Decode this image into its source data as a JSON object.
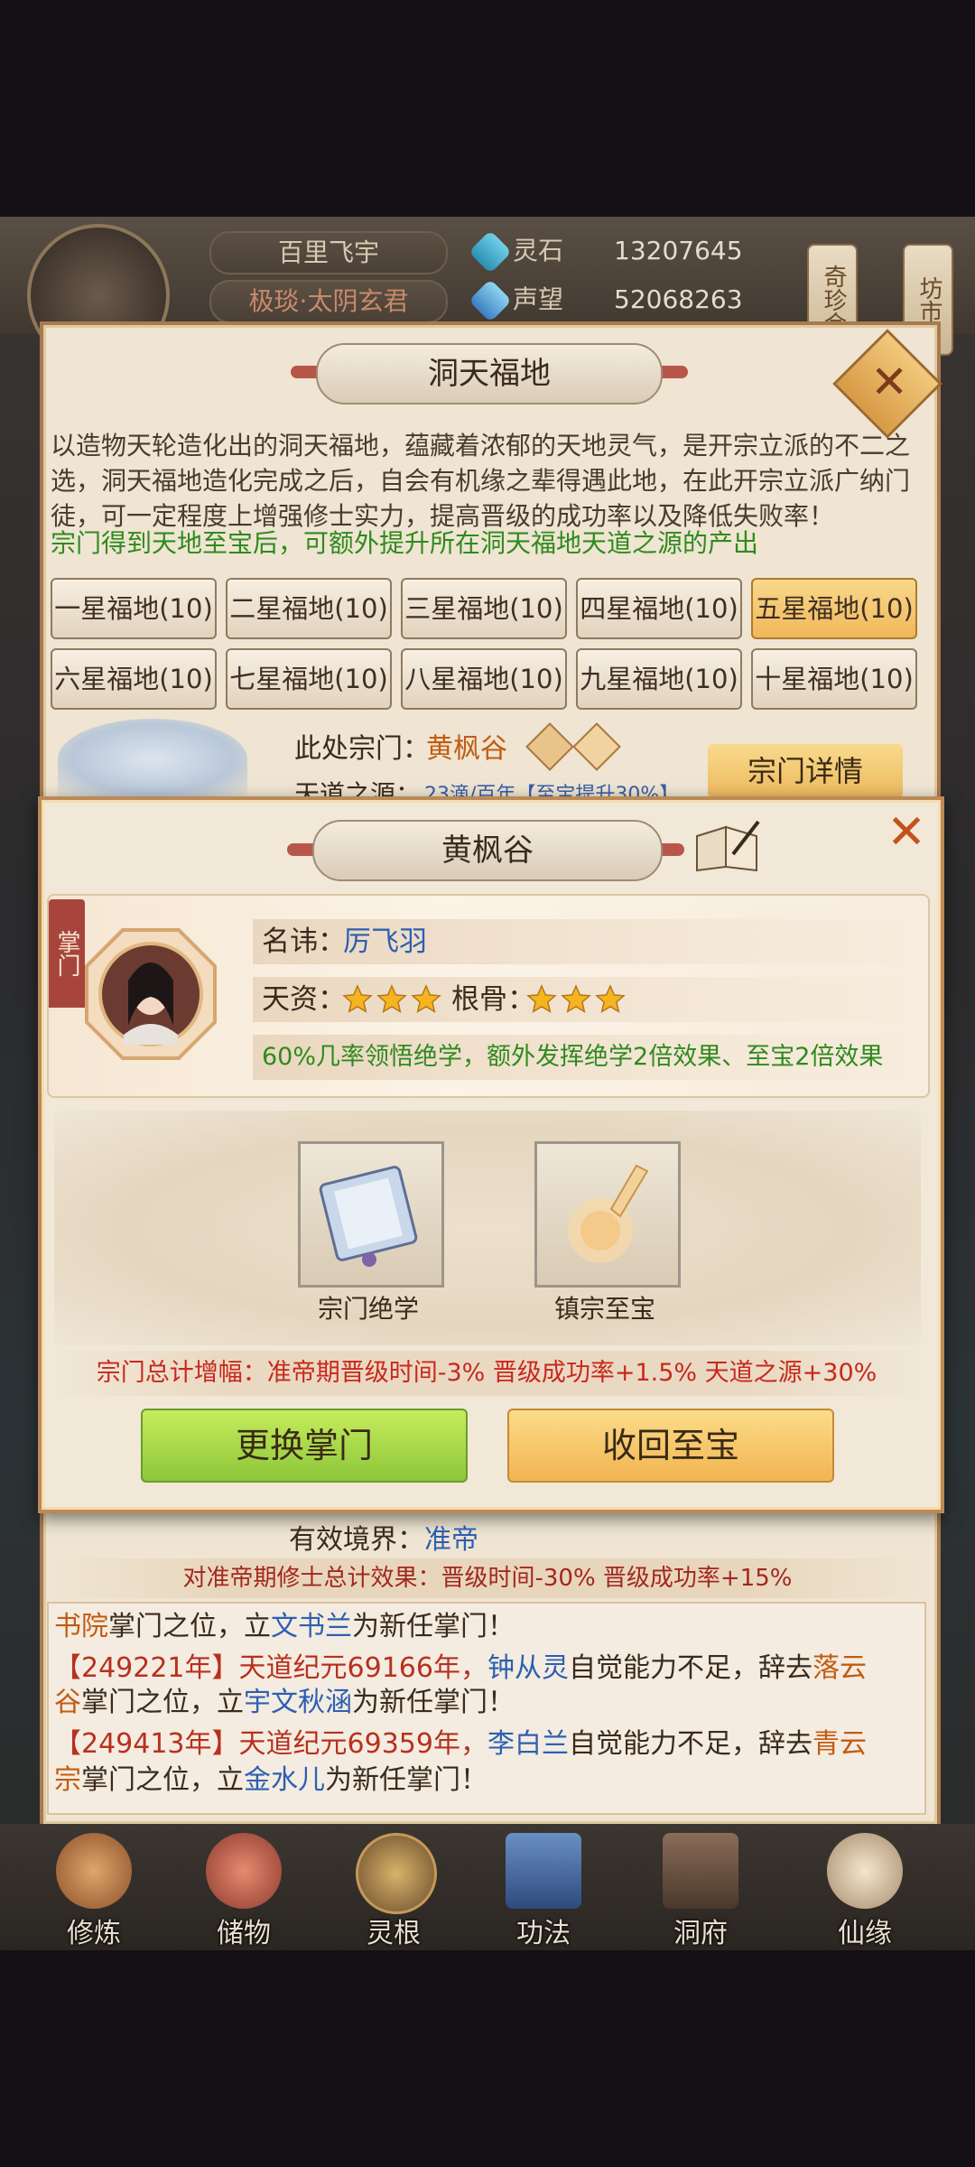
{
  "hud": {
    "player_name": "百里飞宇",
    "player_title": "极琰·太阴玄君",
    "spirit_stone_label": "灵石",
    "spirit_stone_value": "13207645",
    "prestige_label": "声望",
    "prestige_value": "52068263",
    "side_tab_1": "奇珍会",
    "side_tab_2": "坊市"
  },
  "panel": {
    "title": "洞天福地",
    "desc_line1": "以造物天轮造化出的洞天福地，蕴藏着浓郁的天地灵气，是开宗立派的不二之",
    "desc_line2": "选，洞天福地造化完成之后，自会有机缘之辈得遇此地，在此开宗立派广纳门",
    "desc_line3": "徒，可一定程度上增强修士实力，提高晋级的成功率以及降低失败率！",
    "desc_green": "宗门得到天地至宝后，可额外提升所在洞天福地天道之源的产出",
    "tiers": [
      "一星福地(10)",
      "二星福地(10)",
      "三星福地(10)",
      "四星福地(10)",
      "五星福地(10)",
      "六星福地(10)",
      "七星福地(10)",
      "八星福地(10)",
      "九星福地(10)",
      "十星福地(10)"
    ],
    "selected_tier_index": 4,
    "sect_here_label": "此处宗门：",
    "sect_here_value": "黄枫谷",
    "tiandao_label": "天道之源：",
    "tiandao_value": "23滴/百年【至宝提升30%】",
    "sect_detail_button": "宗门详情",
    "realm_label": "有效境界：",
    "realm_value": "准帝",
    "effect_text": "对准帝期修士总计效果：晋级时间-30% 晋级成功率+15%"
  },
  "modal": {
    "title": "黄枫谷",
    "ribbon": "掌门",
    "name_label": "名讳：",
    "name_value": "厉飞羽",
    "talent_label": "天资：",
    "talent_stars": 3,
    "bone_label": "根骨：",
    "bone_stars": 3,
    "trait": "60%几率领悟绝学，额外发挥绝学2倍效果、至宝2倍效果",
    "item1_label": "宗门绝学",
    "item2_label": "镇宗至宝",
    "bonus_text": "宗门总计增幅：准帝期晋级时间-3% 晋级成功率+1.5% 天道之源+30%",
    "btn_change": "更换掌门",
    "btn_recall": "收回至宝"
  },
  "log": {
    "line1_a": "书院",
    "line1_b": "掌门之位，立",
    "line1_c": "文书兰",
    "line1_d": "为新任掌门！",
    "line2_a": "【249221年】天道纪元69166年，",
    "line2_b": "钟从灵",
    "line2_c": "自觉能力不足，辞去",
    "line2_d": "落云",
    "line3_a": "谷",
    "line3_b": "掌门之位，立",
    "line3_c": "宇文秋涵",
    "line3_d": "为新任掌门！",
    "line4_a": "【249413年】天道纪元69359年，",
    "line4_b": "李白兰",
    "line4_c": "自觉能力不足，辞去",
    "line4_d": "青云",
    "line5_a": "宗",
    "line5_b": "掌门之位，立",
    "line5_c": "金水儿",
    "line5_d": "为新任掌门！"
  },
  "nav": {
    "items": [
      "修炼",
      "储物",
      "灵根",
      "功法",
      "洞府",
      "仙缘"
    ]
  },
  "colors": {
    "accent_gold": "#f0b85a",
    "accent_green": "#9fd23e",
    "text_red": "#c8281d",
    "text_blue": "#2d5fb3",
    "text_green": "#2f8a1e"
  }
}
